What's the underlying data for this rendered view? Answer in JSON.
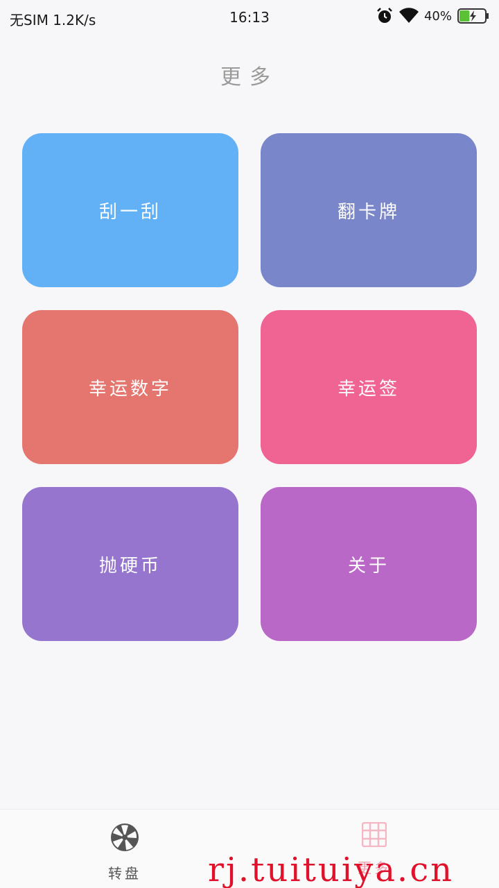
{
  "status_bar": {
    "carrier": "无SIM 1.2K/s",
    "time": "16:13",
    "battery_percent": "40%",
    "battery_level": 0.4
  },
  "page": {
    "title": "更多"
  },
  "tiles": [
    {
      "label": "刮一刮",
      "color": "#62b1f6"
    },
    {
      "label": "翻卡牌",
      "color": "#7986c9"
    },
    {
      "label": "幸运数字",
      "color": "#e4756f"
    },
    {
      "label": "幸运签",
      "color": "#f06493"
    },
    {
      "label": "抛硬币",
      "color": "#9575cd"
    },
    {
      "label": "关于",
      "color": "#ba68c8"
    }
  ],
  "bottom_nav": {
    "items": [
      {
        "label": "转盘",
        "icon": "wheel-icon"
      },
      {
        "label": "更多",
        "icon": "grid-icon"
      }
    ]
  },
  "watermark": "rj.tuituiya.cn"
}
